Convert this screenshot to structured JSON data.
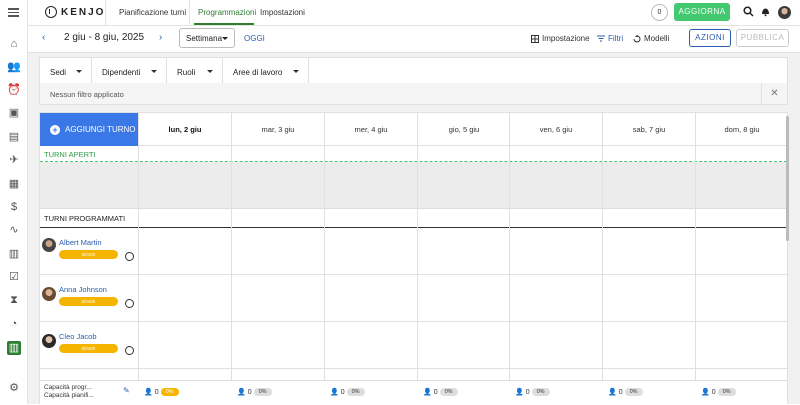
{
  "app": {
    "logo": "KENJO",
    "nav": [
      "Pianificazione turni",
      "Programmazioni",
      "Impostazioni"
    ],
    "counter": "0",
    "update_button": "AGGIORNA"
  },
  "sidebar_icons": [
    "home-icon",
    "people-icon",
    "alarm-icon",
    "briefcase-icon",
    "document-icon",
    "plane-icon",
    "calendar-icon",
    "dollar-icon",
    "pulse-icon",
    "bar-chart-icon",
    "checklist-icon",
    "hourglass-icon",
    "gauge-icon",
    "schedule-grid-icon",
    "settings-icon"
  ],
  "toolbar": {
    "prev": "‹",
    "next": "›",
    "date_range": "2 giu - 8 giu, 2025",
    "view": "Settimana",
    "today": "OGGI",
    "setup": "Impostazione",
    "filters": "Filtri",
    "templates": "Modelli",
    "actions": "AZIONI",
    "publish": "PUBBLICA"
  },
  "filters": {
    "dropdowns": [
      "Sedi",
      "Dipendenti",
      "Ruoli",
      "Aree di lavoro"
    ],
    "status": "Nessun filtro applicato"
  },
  "grid": {
    "add_shift": "AGGIUNGI TURNO",
    "days": [
      "lun, 2 giu",
      "mar, 3 giu",
      "mer, 4 giu",
      "gio, 5 giu",
      "ven, 6 giu",
      "sab, 7 giu",
      "dom, 8 giu"
    ],
    "open_shifts_label": "TURNI APERTI",
    "scheduled_label": "TURNI PROGRAMMATI",
    "employees": [
      {
        "name": "Albert Martin",
        "hours": "0h/30h"
      },
      {
        "name": "Anna Johnson",
        "hours": "0h/40h"
      },
      {
        "name": "Cleo Jacob",
        "hours": "0h/40h"
      }
    ],
    "capacity": {
      "label1": "Capacità progr...",
      "label2": "Capacità pianifi...",
      "cells": [
        {
          "count": "0",
          "pct": "0%"
        },
        {
          "count": "0",
          "pct": "0%"
        },
        {
          "count": "0",
          "pct": "0%"
        },
        {
          "count": "0",
          "pct": "0%"
        },
        {
          "count": "0",
          "pct": "0%"
        },
        {
          "count": "0",
          "pct": "0%"
        },
        {
          "count": "0",
          "pct": "0%"
        }
      ]
    }
  },
  "colors": {
    "accent_green": "#43c96f",
    "accent_blue": "#3b78e7",
    "warning_yellow": "#f5b400"
  }
}
